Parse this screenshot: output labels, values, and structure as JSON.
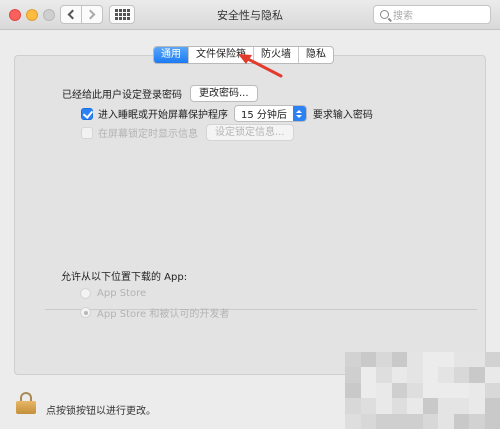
{
  "window": {
    "title": "安全性与隐私",
    "search_placeholder": "搜索"
  },
  "tabs": [
    {
      "label": "通用",
      "active": true
    },
    {
      "label": "文件保险箱",
      "active": false
    },
    {
      "label": "防火墙",
      "active": false
    },
    {
      "label": "隐私",
      "active": false
    }
  ],
  "general": {
    "password_set_label": "已经给此用户设定登录密码",
    "change_password_button": "更改密码...",
    "require_password_prefix": "进入睡眠或开始屏幕保护程序",
    "require_password_delay": "15 分钟后",
    "require_password_suffix": "要求输入密码",
    "show_message_label": "在屏幕锁定时显示信息",
    "set_lock_message_button": "设定锁定信息..."
  },
  "downloads": {
    "heading": "允许从以下位置下载的 App:",
    "option_app_store": "App Store",
    "option_identified": "App Store 和被认可的开发者"
  },
  "footer": {
    "lock_text": "点按锁按钮以进行更改。"
  },
  "colors": {
    "accent": "#2c82f5",
    "annotation_arrow": "#e23a2c"
  }
}
